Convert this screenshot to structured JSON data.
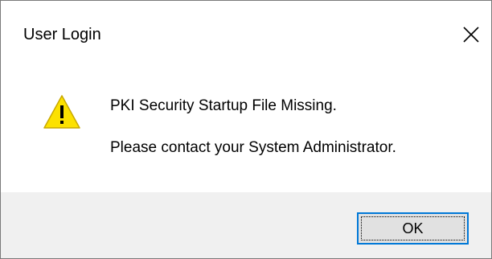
{
  "window": {
    "title": "User Login",
    "close_icon": "close-icon"
  },
  "message": {
    "icon": "warning-icon",
    "line1": "PKI Security Startup File Missing.",
    "line2": "Please contact your System Administrator."
  },
  "buttons": {
    "ok_label": "OK"
  },
  "colors": {
    "warning_fill": "#FCE100",
    "focus_border": "#0078D7",
    "footer_bg": "#F0F0F0"
  }
}
